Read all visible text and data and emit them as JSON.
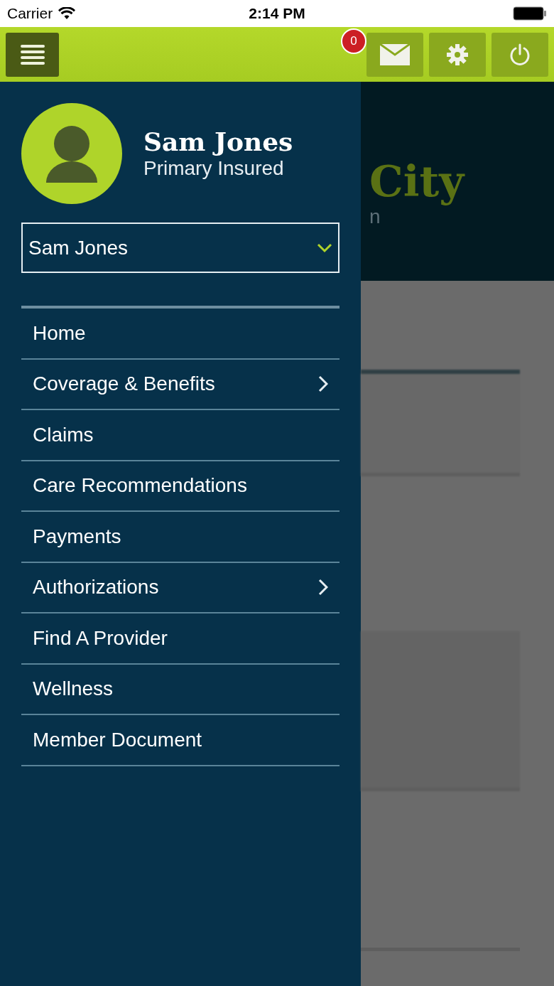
{
  "status_bar": {
    "carrier": "Carrier",
    "time": "2:14 PM"
  },
  "top_bar": {
    "message_count": "0"
  },
  "profile": {
    "name": "Sam Jones",
    "role": "Primary Insured"
  },
  "member_select": {
    "value": "Sam Jones"
  },
  "menu": [
    {
      "label": "Home",
      "has_submenu": false
    },
    {
      "label": "Coverage & Benefits",
      "has_submenu": true
    },
    {
      "label": "Claims",
      "has_submenu": false
    },
    {
      "label": "Care Recommendations",
      "has_submenu": false
    },
    {
      "label": "Payments",
      "has_submenu": false
    },
    {
      "label": "Authorizations",
      "has_submenu": true
    },
    {
      "label": "Find A Provider",
      "has_submenu": false
    },
    {
      "label": "Wellness",
      "has_submenu": false
    },
    {
      "label": "Member Document",
      "has_submenu": false
    }
  ],
  "background_page": {
    "title": "City",
    "subtitle": "n"
  }
}
